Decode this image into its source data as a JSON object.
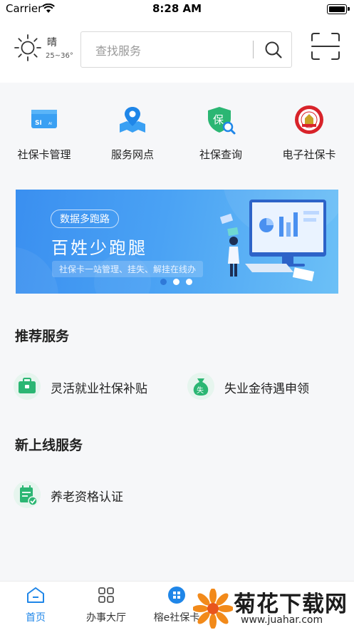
{
  "status_bar": {
    "carrier": "Carrier",
    "time": "8:28 AM"
  },
  "header": {
    "weather": {
      "condition": "晴",
      "temperature": "25~36°"
    },
    "search": {
      "placeholder": "查找服务"
    }
  },
  "quick_entries": [
    {
      "label": "社保卡管理",
      "icon": "si-card-icon"
    },
    {
      "label": "服务网点",
      "icon": "map-pin-icon"
    },
    {
      "label": "社保查询",
      "icon": "shield-search-icon"
    },
    {
      "label": "电子社保卡",
      "icon": "social-security-badge-icon"
    }
  ],
  "banner": {
    "tag": "数据多跑路",
    "title": "百姓少跑腿",
    "subtitle": "社保卡一站管理、挂失、解挂在线办",
    "active_dot": 1,
    "dot_count": 3
  },
  "recommended": {
    "title": "推荐服务",
    "items": [
      {
        "label": "灵活就业社保补贴",
        "icon": "briefcase-icon"
      },
      {
        "label": "失业金待遇申领",
        "icon": "money-bag-icon"
      }
    ]
  },
  "new_services": {
    "title": "新上线服务",
    "items": [
      {
        "label": "养老资格认证",
        "icon": "calendar-check-icon"
      }
    ]
  },
  "tab_bar": {
    "tabs": [
      {
        "label": "首页",
        "icon": "home-icon",
        "active": true
      },
      {
        "label": "办事大厅",
        "icon": "grid-icon",
        "active": false
      },
      {
        "label": "榕e社保卡",
        "icon": "qr-badge-icon",
        "active": false
      }
    ]
  },
  "watermark": {
    "text": "菊花下载网",
    "url": "www.juahar.com"
  },
  "colors": {
    "accent": "#1f86e8",
    "green": "#2bb673",
    "background": "#f6f7f9",
    "banner": "#3a8ff0"
  }
}
